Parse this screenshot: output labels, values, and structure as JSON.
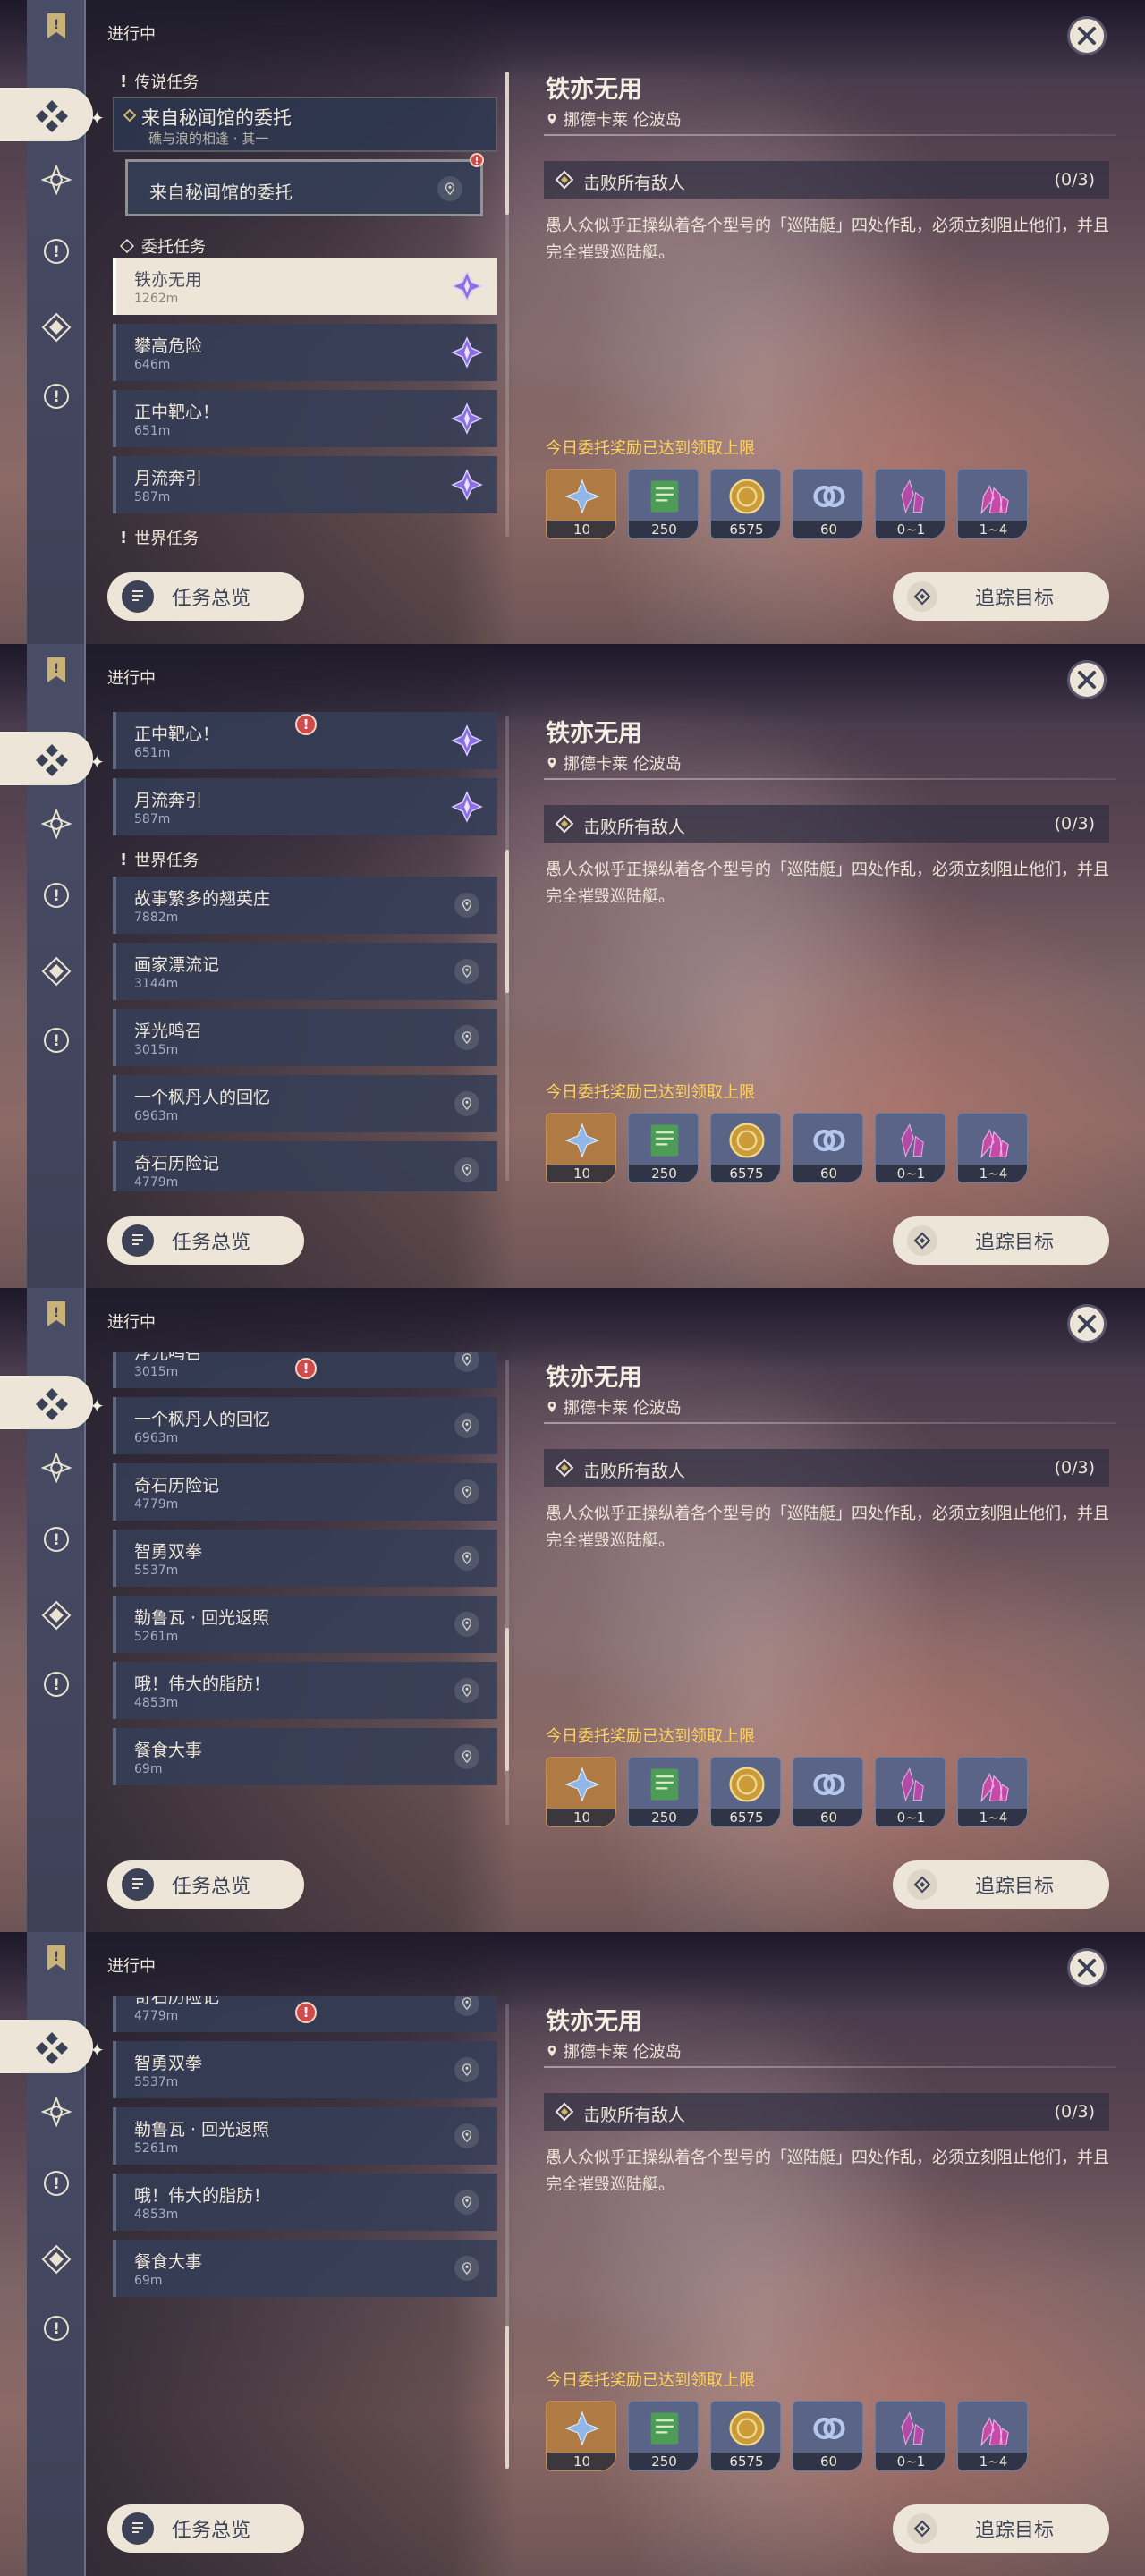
{
  "status": "进行中",
  "detail": {
    "title": "铁亦无用",
    "location": "挪德卡莱 伦波岛",
    "objective": "击败所有敌人",
    "objective_count": "(0/3)",
    "description": "愚人众似乎正操纵着各个型号的「巡陆艇」四处作乱，必须立刻阻止他们，并且完全摧毁巡陆艇。",
    "reward_title": "今日委托奖励已达到领取上限",
    "rewards": [
      {
        "icon": "primogem-icon",
        "count": "10"
      },
      {
        "icon": "adventure-exp-icon",
        "count": "250"
      },
      {
        "icon": "mora-icon",
        "count": "6575"
      },
      {
        "icon": "friendship-exp-icon",
        "count": "60"
      },
      {
        "icon": "crystal-fragment-icon",
        "count": "0~1"
      },
      {
        "icon": "crystal-chunk-icon",
        "count": "1~4"
      }
    ]
  },
  "buttons": {
    "overview": "任务总览",
    "track": "追踪目标"
  },
  "sections": {
    "legend": "传说任务",
    "commission": "委托任务",
    "world": "世界任务"
  },
  "legend_quest": {
    "name": "来自秘闻馆的委托",
    "subtitle": "礁与浪的相逢 · 其一",
    "child": "来自秘闻馆的委托"
  },
  "commissions": [
    {
      "name": "铁亦无用",
      "dist": "1262m"
    },
    {
      "name": "攀高危险",
      "dist": "646m"
    },
    {
      "name": "正中靶心！",
      "dist": "651m"
    },
    {
      "name": "月流奔引",
      "dist": "587m"
    }
  ],
  "world_quests": [
    {
      "name": "故事繁多的翘英庄",
      "dist": "7882m"
    },
    {
      "name": "画家漂流记",
      "dist": "3144m"
    },
    {
      "name": "浮光鸣召",
      "dist": "3015m"
    },
    {
      "name": "一个枫丹人的回忆",
      "dist": "6963m"
    },
    {
      "name": "奇石历险记",
      "dist": "4779m"
    },
    {
      "name": "智勇双拳",
      "dist": "5537m"
    },
    {
      "name": "勒鲁瓦 · 回光返照",
      "dist": "5261m"
    },
    {
      "name": "哦！伟大的脂肪！",
      "dist": "4853m"
    },
    {
      "name": "餐食大事",
      "dist": "69m"
    }
  ],
  "colors": {
    "cream": "#ece5d8",
    "gold": "#ffd35a",
    "warning": "#d04a4a",
    "purple": "#8b6fe0"
  }
}
